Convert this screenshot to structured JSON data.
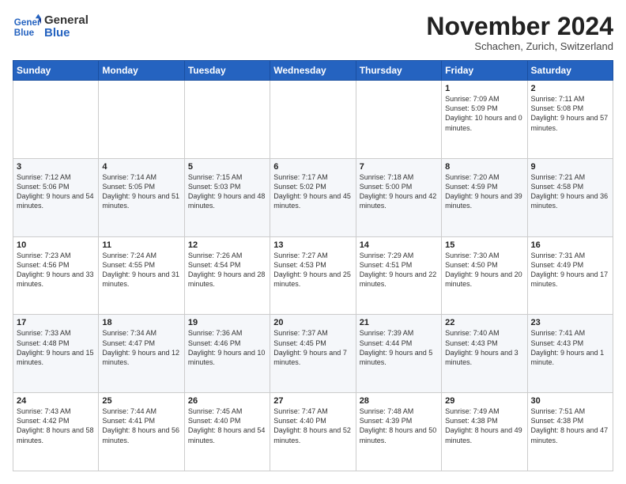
{
  "logo": {
    "line1": "General",
    "line2": "Blue"
  },
  "title": "November 2024",
  "location": "Schachen, Zurich, Switzerland",
  "days_of_week": [
    "Sunday",
    "Monday",
    "Tuesday",
    "Wednesday",
    "Thursday",
    "Friday",
    "Saturday"
  ],
  "weeks": [
    [
      {
        "day": "",
        "info": ""
      },
      {
        "day": "",
        "info": ""
      },
      {
        "day": "",
        "info": ""
      },
      {
        "day": "",
        "info": ""
      },
      {
        "day": "",
        "info": ""
      },
      {
        "day": "1",
        "info": "Sunrise: 7:09 AM\nSunset: 5:09 PM\nDaylight: 10 hours and 0 minutes."
      },
      {
        "day": "2",
        "info": "Sunrise: 7:11 AM\nSunset: 5:08 PM\nDaylight: 9 hours and 57 minutes."
      }
    ],
    [
      {
        "day": "3",
        "info": "Sunrise: 7:12 AM\nSunset: 5:06 PM\nDaylight: 9 hours and 54 minutes."
      },
      {
        "day": "4",
        "info": "Sunrise: 7:14 AM\nSunset: 5:05 PM\nDaylight: 9 hours and 51 minutes."
      },
      {
        "day": "5",
        "info": "Sunrise: 7:15 AM\nSunset: 5:03 PM\nDaylight: 9 hours and 48 minutes."
      },
      {
        "day": "6",
        "info": "Sunrise: 7:17 AM\nSunset: 5:02 PM\nDaylight: 9 hours and 45 minutes."
      },
      {
        "day": "7",
        "info": "Sunrise: 7:18 AM\nSunset: 5:00 PM\nDaylight: 9 hours and 42 minutes."
      },
      {
        "day": "8",
        "info": "Sunrise: 7:20 AM\nSunset: 4:59 PM\nDaylight: 9 hours and 39 minutes."
      },
      {
        "day": "9",
        "info": "Sunrise: 7:21 AM\nSunset: 4:58 PM\nDaylight: 9 hours and 36 minutes."
      }
    ],
    [
      {
        "day": "10",
        "info": "Sunrise: 7:23 AM\nSunset: 4:56 PM\nDaylight: 9 hours and 33 minutes."
      },
      {
        "day": "11",
        "info": "Sunrise: 7:24 AM\nSunset: 4:55 PM\nDaylight: 9 hours and 31 minutes."
      },
      {
        "day": "12",
        "info": "Sunrise: 7:26 AM\nSunset: 4:54 PM\nDaylight: 9 hours and 28 minutes."
      },
      {
        "day": "13",
        "info": "Sunrise: 7:27 AM\nSunset: 4:53 PM\nDaylight: 9 hours and 25 minutes."
      },
      {
        "day": "14",
        "info": "Sunrise: 7:29 AM\nSunset: 4:51 PM\nDaylight: 9 hours and 22 minutes."
      },
      {
        "day": "15",
        "info": "Sunrise: 7:30 AM\nSunset: 4:50 PM\nDaylight: 9 hours and 20 minutes."
      },
      {
        "day": "16",
        "info": "Sunrise: 7:31 AM\nSunset: 4:49 PM\nDaylight: 9 hours and 17 minutes."
      }
    ],
    [
      {
        "day": "17",
        "info": "Sunrise: 7:33 AM\nSunset: 4:48 PM\nDaylight: 9 hours and 15 minutes."
      },
      {
        "day": "18",
        "info": "Sunrise: 7:34 AM\nSunset: 4:47 PM\nDaylight: 9 hours and 12 minutes."
      },
      {
        "day": "19",
        "info": "Sunrise: 7:36 AM\nSunset: 4:46 PM\nDaylight: 9 hours and 10 minutes."
      },
      {
        "day": "20",
        "info": "Sunrise: 7:37 AM\nSunset: 4:45 PM\nDaylight: 9 hours and 7 minutes."
      },
      {
        "day": "21",
        "info": "Sunrise: 7:39 AM\nSunset: 4:44 PM\nDaylight: 9 hours and 5 minutes."
      },
      {
        "day": "22",
        "info": "Sunrise: 7:40 AM\nSunset: 4:43 PM\nDaylight: 9 hours and 3 minutes."
      },
      {
        "day": "23",
        "info": "Sunrise: 7:41 AM\nSunset: 4:43 PM\nDaylight: 9 hours and 1 minute."
      }
    ],
    [
      {
        "day": "24",
        "info": "Sunrise: 7:43 AM\nSunset: 4:42 PM\nDaylight: 8 hours and 58 minutes."
      },
      {
        "day": "25",
        "info": "Sunrise: 7:44 AM\nSunset: 4:41 PM\nDaylight: 8 hours and 56 minutes."
      },
      {
        "day": "26",
        "info": "Sunrise: 7:45 AM\nSunset: 4:40 PM\nDaylight: 8 hours and 54 minutes."
      },
      {
        "day": "27",
        "info": "Sunrise: 7:47 AM\nSunset: 4:40 PM\nDaylight: 8 hours and 52 minutes."
      },
      {
        "day": "28",
        "info": "Sunrise: 7:48 AM\nSunset: 4:39 PM\nDaylight: 8 hours and 50 minutes."
      },
      {
        "day": "29",
        "info": "Sunrise: 7:49 AM\nSunset: 4:38 PM\nDaylight: 8 hours and 49 minutes."
      },
      {
        "day": "30",
        "info": "Sunrise: 7:51 AM\nSunset: 4:38 PM\nDaylight: 8 hours and 47 minutes."
      }
    ]
  ]
}
